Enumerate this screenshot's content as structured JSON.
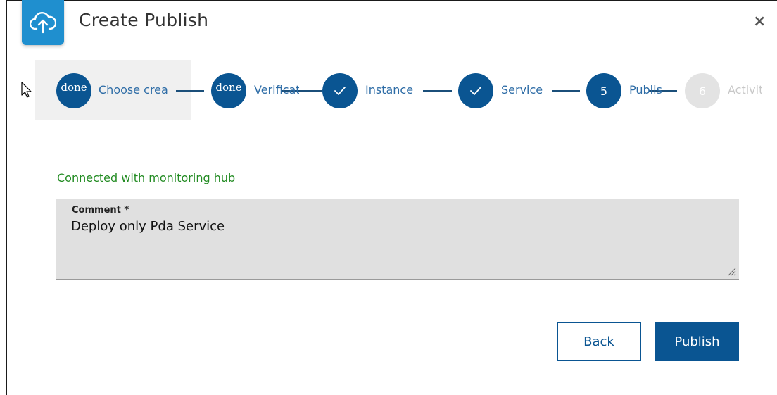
{
  "dialog": {
    "title": "Create Publish",
    "close_symbol": "×",
    "logo_icon": "cloud-upload-icon"
  },
  "stepper": {
    "steps": [
      {
        "marker": "done",
        "label": "Choose crea",
        "state": "done"
      },
      {
        "marker": "done",
        "label": "Verificat",
        "state": "done"
      },
      {
        "marker": "check",
        "label": "Instance",
        "state": "completed"
      },
      {
        "marker": "check",
        "label": "Service",
        "state": "completed"
      },
      {
        "marker": "5",
        "label": "Publis",
        "state": "active"
      },
      {
        "marker": "6",
        "label": "Activit",
        "state": "inactive"
      }
    ]
  },
  "status_text": "Connected with monitoring hub",
  "comment": {
    "label": "Comment *",
    "value": "Deploy only Pda Service"
  },
  "buttons": {
    "back": "Back",
    "publish": "Publish"
  },
  "colors": {
    "primary": "#0a5592",
    "logo_bg": "#1f8fcf",
    "status_green": "#228b22",
    "inactive": "#e3e3e3"
  }
}
